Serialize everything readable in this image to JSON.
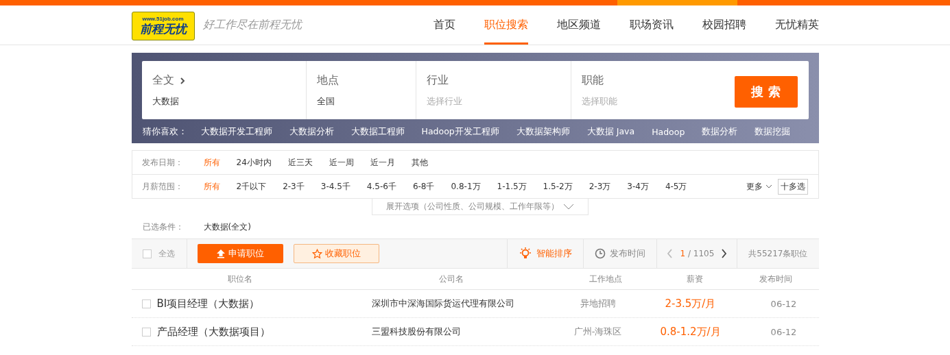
{
  "header": {
    "logo_url": "www.51job.com",
    "logo_text": "前程无忧",
    "slogan": "好工作尽在前程无忧",
    "nav": [
      {
        "label": "首页",
        "selected": false
      },
      {
        "label": "职位搜索",
        "selected": true
      },
      {
        "label": "地区频道",
        "selected": false
      },
      {
        "label": "职场资讯",
        "selected": false
      },
      {
        "label": "校园招聘",
        "selected": false
      },
      {
        "label": "无忧精英",
        "selected": false
      }
    ]
  },
  "search": {
    "fields": [
      {
        "label": "全文",
        "value": "大数据",
        "kind": "dropdown"
      },
      {
        "label": "地点",
        "value": "全国",
        "kind": "plain"
      },
      {
        "label": "行业",
        "placeholder": "选择行业",
        "kind": "plain"
      },
      {
        "label": "职能",
        "placeholder": "选择职能",
        "kind": "plain"
      }
    ],
    "button": "搜 索",
    "suggest_label": "猜你喜欢：",
    "suggestions": [
      "大数据开发工程师",
      "大数据分析",
      "大数据工程师",
      "Hadoop开发工程师",
      "大数据架构师",
      "大数据 Java",
      "Hadoop",
      "数据分析",
      "数据挖掘"
    ]
  },
  "filters": [
    {
      "label": "发布日期：",
      "options": [
        {
          "label": "所有",
          "selected": true
        },
        {
          "label": "24小时内",
          "selected": false
        },
        {
          "label": "近三天",
          "selected": false
        },
        {
          "label": "近一周",
          "selected": false
        },
        {
          "label": "近一月",
          "selected": false
        },
        {
          "label": "其他",
          "selected": false
        }
      ]
    },
    {
      "label": "月薪范围：",
      "options": [
        {
          "label": "所有",
          "selected": true
        },
        {
          "label": "2千以下",
          "selected": false
        },
        {
          "label": "2-3千",
          "selected": false
        },
        {
          "label": "3-4.5千",
          "selected": false
        },
        {
          "label": "4.5-6千",
          "selected": false
        },
        {
          "label": "6-8千",
          "selected": false
        },
        {
          "label": "0.8-1万",
          "selected": false
        },
        {
          "label": "1-1.5万",
          "selected": false
        },
        {
          "label": "1.5-2万",
          "selected": false
        },
        {
          "label": "2-3万",
          "selected": false
        },
        {
          "label": "3-4万",
          "selected": false
        },
        {
          "label": "4-5万",
          "selected": false
        }
      ],
      "more": "更多",
      "multi": "十多选"
    }
  ],
  "expand": "展开选项（公司性质、公司规模、工作年限等）",
  "selected_conditions": {
    "label": "已选条件：",
    "value": "大数据(全文)"
  },
  "toolbar": {
    "select_all": {
      "label": "全选",
      "checked": false
    },
    "apply": "申请职位",
    "favorite": "收藏职位",
    "sort_smart": {
      "label": "智能排序",
      "selected": true
    },
    "sort_time": {
      "label": "发布时间",
      "selected": false
    },
    "page_current": "1",
    "page_total": "/ 1105",
    "total": "共55217条职位"
  },
  "table": {
    "columns": [
      "职位名",
      "公司名",
      "工作地点",
      "薪资",
      "发布时间"
    ],
    "rows": [
      {
        "checked": false,
        "title": "BI项目经理（大数据）",
        "company": "深圳市中深海国际货运代理有限公司",
        "location": "异地招聘",
        "salary": "2-3.5万/月",
        "date": "06-12"
      },
      {
        "checked": false,
        "title": "产品经理（大数据项目）",
        "company": "三盟科技股份有限公司",
        "location": "广州-海珠区",
        "salary": "0.8-1.2万/月",
        "date": "06-12"
      }
    ]
  }
}
